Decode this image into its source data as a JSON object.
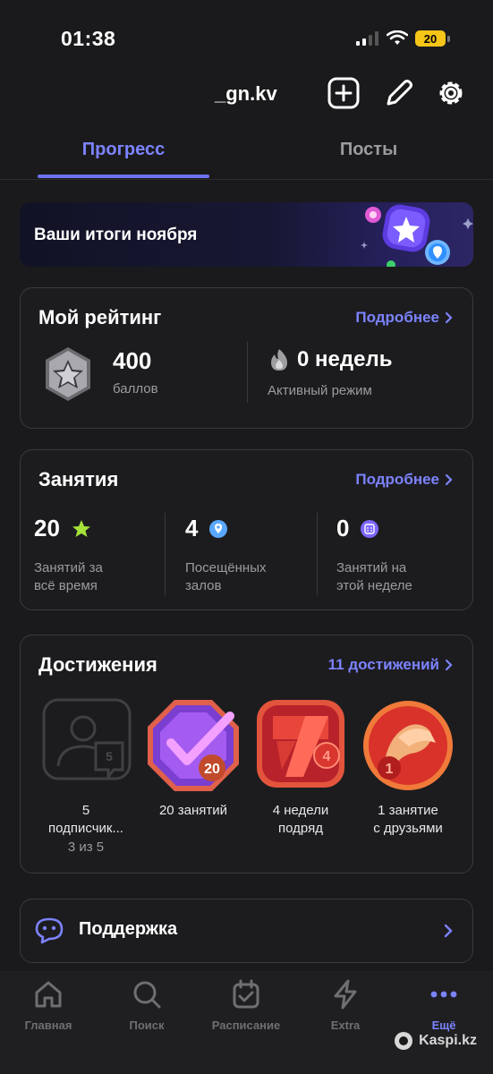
{
  "status": {
    "time": "01:38",
    "battery": "20"
  },
  "header": {
    "username": "_gn.kv"
  },
  "tabs": [
    {
      "label": "Прогресс"
    },
    {
      "label": "Посты"
    }
  ],
  "banner": {
    "text": "Ваши итоги ноября"
  },
  "rating": {
    "title": "Мой рейтинг",
    "link": "Подробнее",
    "points_value": "400",
    "points_label": "баллов",
    "weeks_value": "0 недель",
    "weeks_label": "Активный режим"
  },
  "classes": {
    "title": "Занятия",
    "link": "Подробнее",
    "stats": [
      {
        "value": "20",
        "label1": "Занятий за",
        "label2": "всё время"
      },
      {
        "value": "4",
        "label1": "Посещённых",
        "label2": "залов"
      },
      {
        "value": "0",
        "label1": "Занятий на",
        "label2": "этой неделе"
      }
    ]
  },
  "achievements": {
    "title": "Достижения",
    "link": "11 достижений",
    "items": [
      {
        "line1": "5",
        "line2": "подписчик...",
        "sub": "3 из 5",
        "badge": "5"
      },
      {
        "line1": "20 занятий",
        "line2": "",
        "badge": "20"
      },
      {
        "line1": "4 недели",
        "line2": "подряд",
        "badge": "4"
      },
      {
        "line1": "1 занятие",
        "line2": "с друзьями",
        "badge": "1"
      }
    ]
  },
  "support": {
    "label": "Поддержка"
  },
  "nav": [
    {
      "label": "Главная",
      "icon": "home-icon"
    },
    {
      "label": "Поиск",
      "icon": "search-icon"
    },
    {
      "label": "Расписание",
      "icon": "calendar-icon"
    },
    {
      "label": "Extra",
      "icon": "lightning-icon"
    },
    {
      "label": "Ещё",
      "icon": "more-icon"
    }
  ],
  "watermark": {
    "text": "Kaspi.kz"
  },
  "colors": {
    "accent": "#7c83ff",
    "background": "#1a1a1c",
    "star_green": "#a6e23a",
    "pin_blue": "#5aa7ff",
    "calendar_purple": "#7c67ff"
  }
}
